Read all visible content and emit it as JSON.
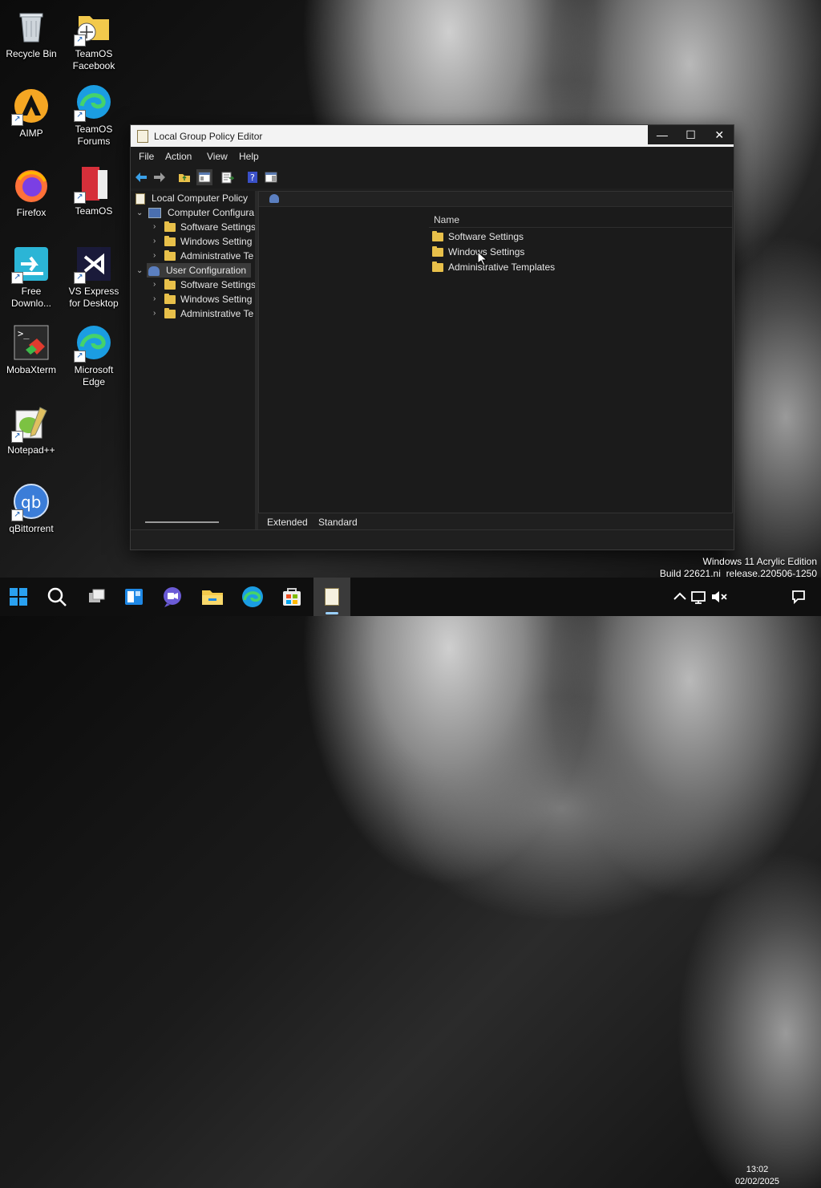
{
  "desktop": {
    "icons": [
      {
        "label": "Recycle Bin"
      },
      {
        "label": "TeamOS Facebook"
      },
      {
        "label": "AIMP"
      },
      {
        "label": "TeamOS Forums"
      },
      {
        "label": "Firefox"
      },
      {
        "label": "TeamOS"
      },
      {
        "label": "Free Downlo..."
      },
      {
        "label": "VS Express for Desktop"
      },
      {
        "label": "MobaXterm"
      },
      {
        "label": "Microsoft Edge"
      },
      {
        "label": "Notepad++"
      },
      {
        "label": "qBittorrent"
      }
    ],
    "watermark": {
      "line1": "Windows 11 Acrylic Edition",
      "line2": "Build 22621.ni_release.220506-1250"
    }
  },
  "window": {
    "title": "Local Group Policy Editor",
    "controls": {
      "minimize": "—",
      "maximize": "☐",
      "close": "✕"
    },
    "menu": [
      "File",
      "Action",
      "View",
      "Help"
    ],
    "tree": {
      "root": "Local Computer Policy",
      "computer": {
        "label": "Computer Configura",
        "children": [
          "Software Settings",
          "Windows Setting",
          "Administrative Te"
        ]
      },
      "user": {
        "label": "User Configuration",
        "children": [
          "Software Settings",
          "Windows Setting",
          "Administrative Te"
        ]
      }
    },
    "content": {
      "column_header": "Name",
      "rows": [
        "Software Settings",
        "Windows Settings",
        "Administrative Templates"
      ]
    },
    "tabs": [
      "Extended",
      "Standard"
    ]
  },
  "taskbar": {
    "time": "13:02",
    "date": "02/02/2025"
  },
  "colors": {
    "accent": "#0078d4",
    "folder": "#e8c04a",
    "window_bg": "#1f1f1f",
    "selection": "#3a3a3a"
  }
}
